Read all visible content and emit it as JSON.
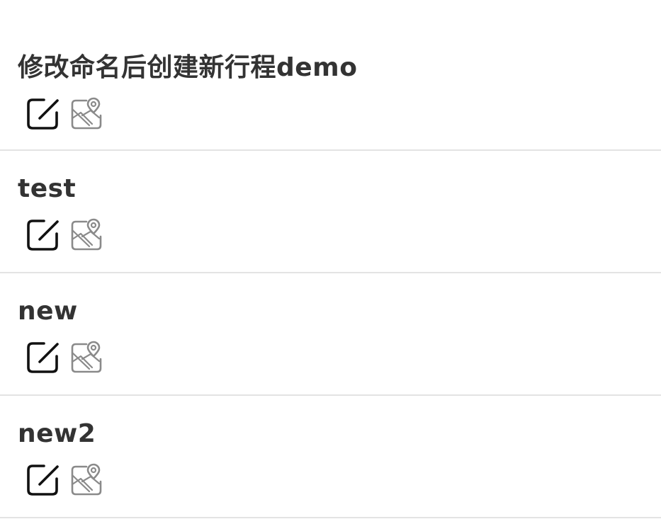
{
  "trips": [
    {
      "title": "修改命名后创建新行程demo",
      "edit_icon": "edit-icon",
      "map_icon": "map-pin-icon"
    },
    {
      "title": "test",
      "edit_icon": "edit-icon",
      "map_icon": "map-pin-icon"
    },
    {
      "title": "new",
      "edit_icon": "edit-icon",
      "map_icon": "map-pin-icon"
    },
    {
      "title": "new2",
      "edit_icon": "edit-icon",
      "map_icon": "map-pin-icon"
    }
  ],
  "colors": {
    "title_text": "#333333",
    "edit_icon": "#111111",
    "map_icon": "#8a8a8a",
    "divider": "#e3e3e3"
  }
}
